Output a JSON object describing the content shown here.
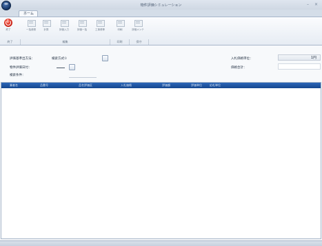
{
  "window": {
    "title": "物件評価シミュレーション",
    "minimize": "–",
    "close": "×"
  },
  "ribbon": {
    "tabs": [
      {
        "label": "ホーム"
      }
    ],
    "buttons": [
      {
        "label": "終了",
        "icon": "power-icon"
      },
      {
        "label": "一括参照",
        "icon": "grid-icon"
      },
      {
        "label": "計算",
        "icon": "calc-icon"
      },
      {
        "label": "評価入力",
        "icon": "edit-icon"
      },
      {
        "label": "評価一括",
        "icon": "batch-icon"
      },
      {
        "label": "工事費等",
        "icon": "tools-icon"
      },
      {
        "label": "印刷",
        "icon": "print-icon"
      },
      {
        "label": "評価メンテ",
        "icon": "settings-icon"
      }
    ],
    "groups": [
      {
        "label": "終了"
      },
      {
        "label": "編集"
      },
      {
        "label": "印刷"
      },
      {
        "label": "保守"
      }
    ]
  },
  "form": {
    "method_label": "評価基準出方法：",
    "method_value": "検索方式①",
    "date_label": "物件評価日付：",
    "date_value": "",
    "condition_label": "検索条件：",
    "unit_label": "入札価格単位：",
    "unit_value": "1円",
    "total_label": "価格合計："
  },
  "grid": {
    "columns": [
      "業者名",
      "品番号",
      "品名評価区",
      "入札価格",
      "評価額",
      "評価単位",
      "応札単位"
    ]
  }
}
